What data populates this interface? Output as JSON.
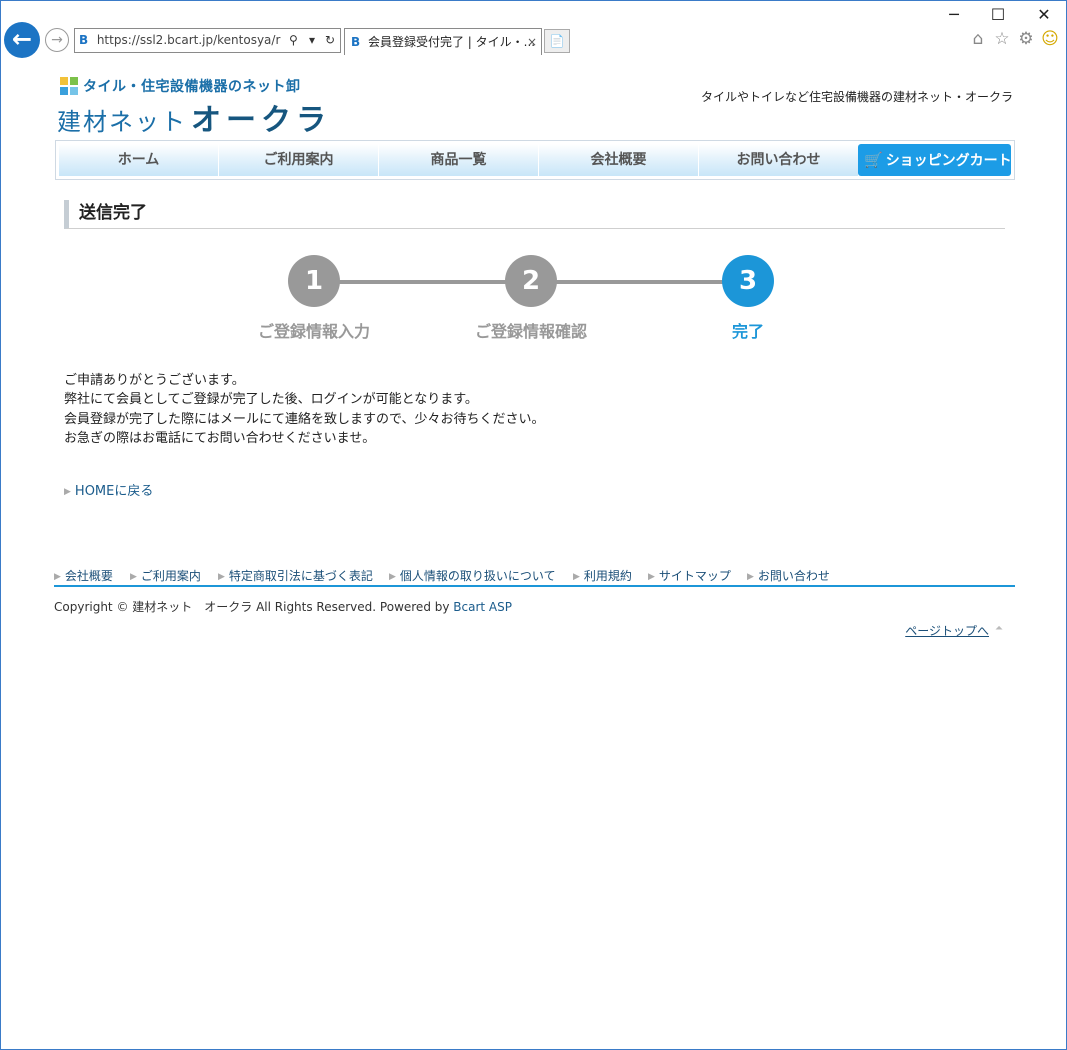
{
  "window": {
    "minimize": "─",
    "maximize": "☐",
    "close": "✕"
  },
  "browser": {
    "back_icon": "←",
    "forward_icon": "→",
    "address": "https://ssl2.bcart.jp/kentosya/r",
    "address_favicon": "B",
    "tab_title": "会員登録受付完了 | タイル・...",
    "tab_favicon": "B",
    "tab_close": "×",
    "new_tab": "📄",
    "search_icon": "⚲",
    "dropdown_icon": "▾",
    "refresh_icon": "↻",
    "home_icon": "⌂",
    "favorites_icon": "☆",
    "settings_icon": "⚙",
    "smiley_icon": "☺"
  },
  "site": {
    "tagline": "タイル・住宅設備機器のネット卸",
    "brand_prefix": "建材ネット",
    "brand_name": "オークラ",
    "header_right": "タイルやトイレなど住宅設備機器の建材ネット・オークラ",
    "logo_colors": [
      "#f2c23a",
      "#7cc14a",
      "#3aa0dc",
      "#76c4e8"
    ]
  },
  "nav": {
    "items": [
      "ホーム",
      "ご利用案内",
      "商品一覧",
      "会社概要",
      "お問い合わせ"
    ],
    "cart_label": "ショッピングカート",
    "cart_icon": "🛒"
  },
  "page": {
    "title": "送信完了",
    "steps": [
      {
        "number": "1",
        "label": "ご登録情報入力"
      },
      {
        "number": "2",
        "label": "ご登録情報確認"
      },
      {
        "number": "3",
        "label": "完了"
      }
    ],
    "current_step": 3,
    "message_lines": [
      "ご申請ありがとうございます。",
      "弊社にて会員としてご登録が完了した後、ログインが可能となります。",
      "会員登録が完了した際にはメールにて連絡を致しますので、少々お待ちください。",
      "お急ぎの際はお電話にてお問い合わせくださいませ。"
    ],
    "home_link": "HOMEに戻る"
  },
  "footer": {
    "links": [
      "会社概要",
      "ご利用案内",
      "特定商取引法に基づく表記",
      "個人情報の取り扱いについて",
      "利用規約",
      "サイトマップ",
      "お問い合わせ"
    ],
    "copyright": "Copyright © 建材ネット　オークラ All Rights Reserved. Powered by ",
    "powered_by": "Bcart ASP",
    "page_top": "ページトップへ",
    "page_top_icon": "⏶"
  },
  "colors": {
    "accent": "#1c96d8",
    "inactive_step": "#999999",
    "link": "#1b4f78"
  }
}
